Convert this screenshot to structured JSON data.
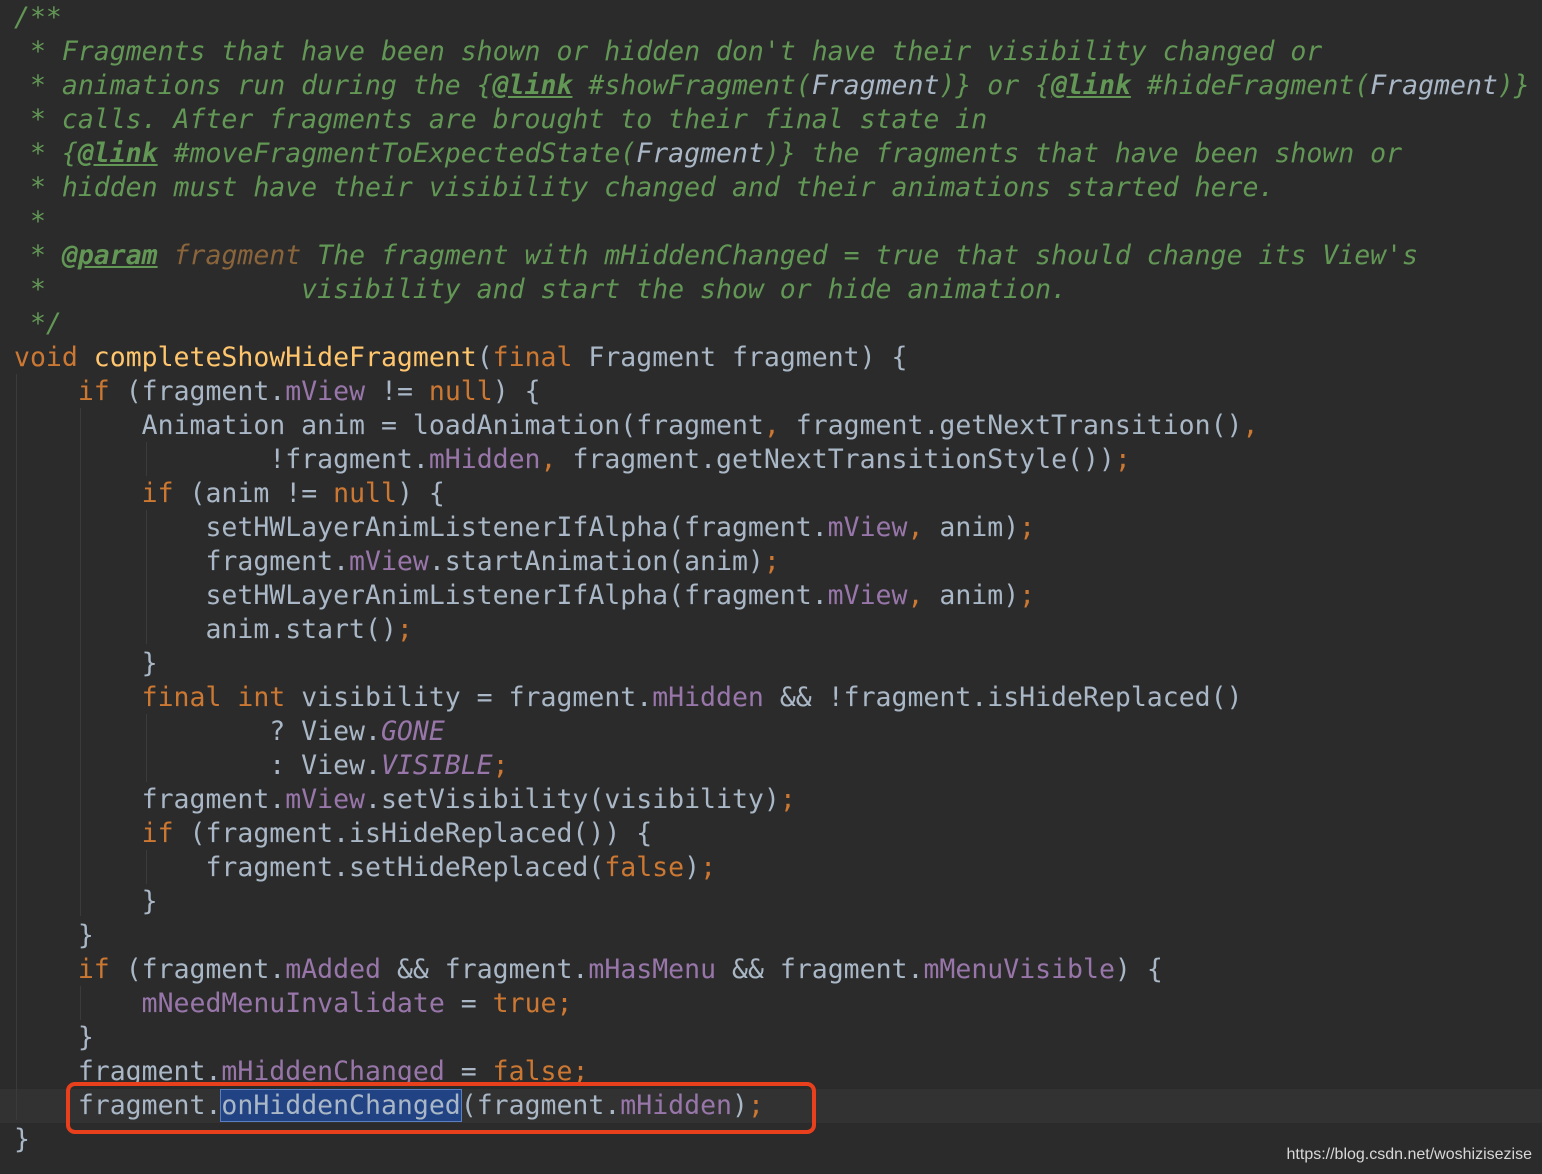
{
  "editor": {
    "theme_colors": {
      "background": "#2b2b2b",
      "plain": "#a9b7c6",
      "keyword": "#cc7832",
      "method_declaration": "#ffc66d",
      "field": "#9876aa",
      "doc_comment": "#629755",
      "highlight_box": "#e8401c",
      "selection": "#214283"
    },
    "lines": [
      {
        "tokens": [
          {
            "t": "/**",
            "c": "doc"
          }
        ]
      },
      {
        "tokens": [
          {
            "t": " * Fragments that have been shown or hidden don't have their visibility changed or",
            "c": "doc"
          }
        ]
      },
      {
        "tokens": [
          {
            "t": " * animations run during the ",
            "c": "doc"
          },
          {
            "t": "{",
            "c": "doc"
          },
          {
            "t": "@link",
            "c": "doctag"
          },
          {
            "t": " #showFragment(",
            "c": "doc"
          },
          {
            "t": "Fragment",
            "c": "docref"
          },
          {
            "t": ")} or ",
            "c": "doc"
          },
          {
            "t": "{",
            "c": "doc"
          },
          {
            "t": "@link",
            "c": "doctag"
          },
          {
            "t": " #hideFragment(",
            "c": "doc"
          },
          {
            "t": "Fragment",
            "c": "docref"
          },
          {
            "t": ")}",
            "c": "doc"
          }
        ]
      },
      {
        "tokens": [
          {
            "t": " * calls. After fragments are brought to their final state in",
            "c": "doc"
          }
        ]
      },
      {
        "tokens": [
          {
            "t": " * ",
            "c": "doc"
          },
          {
            "t": "{",
            "c": "doc"
          },
          {
            "t": "@link",
            "c": "doctag"
          },
          {
            "t": " #moveFragmentToExpectedState(",
            "c": "doc"
          },
          {
            "t": "Fragment",
            "c": "docref"
          },
          {
            "t": ")} the fragments that have been shown or",
            "c": "doc"
          }
        ]
      },
      {
        "tokens": [
          {
            "t": " * hidden must have their visibility changed and their animations started here.",
            "c": "doc"
          }
        ]
      },
      {
        "tokens": [
          {
            "t": " *",
            "c": "doc"
          }
        ]
      },
      {
        "tokens": [
          {
            "t": " * ",
            "c": "doc"
          },
          {
            "t": "@param",
            "c": "doctag"
          },
          {
            "t": " ",
            "c": "doc"
          },
          {
            "t": "fragment",
            "c": "docparam"
          },
          {
            "t": " The fragment with mHiddenChanged = true that should change its View's",
            "c": "doc"
          }
        ]
      },
      {
        "tokens": [
          {
            "t": " *                visibility and start the show or hide animation.",
            "c": "doc"
          }
        ]
      },
      {
        "tokens": [
          {
            "t": " */",
            "c": "doc"
          }
        ]
      },
      {
        "tokens": [
          {
            "t": "void ",
            "c": "kw"
          },
          {
            "t": "completeShowHideFragment",
            "c": "fn"
          },
          {
            "t": "(",
            "c": "plain"
          },
          {
            "t": "final ",
            "c": "kw"
          },
          {
            "t": "Fragment fragment) {",
            "c": "plain"
          }
        ]
      },
      {
        "tokens": [
          {
            "t": "    ",
            "c": "plain"
          },
          {
            "t": "if ",
            "c": "kw"
          },
          {
            "t": "(fragment.",
            "c": "plain"
          },
          {
            "t": "mView",
            "c": "field"
          },
          {
            "t": " != ",
            "c": "plain"
          },
          {
            "t": "null",
            "c": "kw"
          },
          {
            "t": ") {",
            "c": "plain"
          }
        ]
      },
      {
        "tokens": [
          {
            "t": "        Animation anim = loadAnimation(fragment",
            "c": "plain"
          },
          {
            "t": ", ",
            "c": "punct"
          },
          {
            "t": "fragment.getNextTransition()",
            "c": "plain"
          },
          {
            "t": ",",
            "c": "punct"
          }
        ]
      },
      {
        "tokens": [
          {
            "t": "                !fragment.",
            "c": "plain"
          },
          {
            "t": "mHidden",
            "c": "field"
          },
          {
            "t": ", ",
            "c": "punct"
          },
          {
            "t": "fragment.getNextTransitionStyle())",
            "c": "plain"
          },
          {
            "t": ";",
            "c": "punct"
          }
        ]
      },
      {
        "tokens": [
          {
            "t": "        ",
            "c": "plain"
          },
          {
            "t": "if ",
            "c": "kw"
          },
          {
            "t": "(anim != ",
            "c": "plain"
          },
          {
            "t": "null",
            "c": "kw"
          },
          {
            "t": ") {",
            "c": "plain"
          }
        ]
      },
      {
        "tokens": [
          {
            "t": "            setHWLayerAnimListenerIfAlpha(fragment.",
            "c": "plain"
          },
          {
            "t": "mView",
            "c": "field"
          },
          {
            "t": ", ",
            "c": "punct"
          },
          {
            "t": "anim)",
            "c": "plain"
          },
          {
            "t": ";",
            "c": "punct"
          }
        ]
      },
      {
        "tokens": [
          {
            "t": "            fragment.",
            "c": "plain"
          },
          {
            "t": "mView",
            "c": "field"
          },
          {
            "t": ".startAnimation(anim)",
            "c": "plain"
          },
          {
            "t": ";",
            "c": "punct"
          }
        ]
      },
      {
        "tokens": [
          {
            "t": "            setHWLayerAnimListenerIfAlpha(fragment.",
            "c": "plain"
          },
          {
            "t": "mView",
            "c": "field"
          },
          {
            "t": ", ",
            "c": "punct"
          },
          {
            "t": "anim)",
            "c": "plain"
          },
          {
            "t": ";",
            "c": "punct"
          }
        ]
      },
      {
        "tokens": [
          {
            "t": "            anim.start()",
            "c": "plain"
          },
          {
            "t": ";",
            "c": "punct"
          }
        ]
      },
      {
        "tokens": [
          {
            "t": "        }",
            "c": "plain"
          }
        ]
      },
      {
        "tokens": [
          {
            "t": "        ",
            "c": "plain"
          },
          {
            "t": "final int ",
            "c": "kw"
          },
          {
            "t": "visibility = fragment.",
            "c": "plain"
          },
          {
            "t": "mHidden",
            "c": "field"
          },
          {
            "t": " && !fragment.isHideReplaced()",
            "c": "plain"
          }
        ]
      },
      {
        "tokens": [
          {
            "t": "                ? View.",
            "c": "plain"
          },
          {
            "t": "GONE",
            "c": "const"
          }
        ]
      },
      {
        "tokens": [
          {
            "t": "                : View.",
            "c": "plain"
          },
          {
            "t": "VISIBLE",
            "c": "const"
          },
          {
            "t": ";",
            "c": "punct"
          }
        ]
      },
      {
        "tokens": [
          {
            "t": "        fragment.",
            "c": "plain"
          },
          {
            "t": "mView",
            "c": "field"
          },
          {
            "t": ".setVisibility(visibility)",
            "c": "plain"
          },
          {
            "t": ";",
            "c": "punct"
          }
        ]
      },
      {
        "tokens": [
          {
            "t": "        ",
            "c": "plain"
          },
          {
            "t": "if ",
            "c": "kw"
          },
          {
            "t": "(fragment.isHideReplaced()) {",
            "c": "plain"
          }
        ]
      },
      {
        "tokens": [
          {
            "t": "            fragment.setHideReplaced(",
            "c": "plain"
          },
          {
            "t": "false",
            "c": "kw"
          },
          {
            "t": ")",
            "c": "plain"
          },
          {
            "t": ";",
            "c": "punct"
          }
        ]
      },
      {
        "tokens": [
          {
            "t": "        }",
            "c": "plain"
          }
        ]
      },
      {
        "tokens": [
          {
            "t": "    }",
            "c": "plain"
          }
        ]
      },
      {
        "tokens": [
          {
            "t": "    ",
            "c": "plain"
          },
          {
            "t": "if ",
            "c": "kw"
          },
          {
            "t": "(fragment.",
            "c": "plain"
          },
          {
            "t": "mAdded",
            "c": "field"
          },
          {
            "t": " && fragment.",
            "c": "plain"
          },
          {
            "t": "mHasMenu",
            "c": "field"
          },
          {
            "t": " && fragment.",
            "c": "plain"
          },
          {
            "t": "mMenuVisible",
            "c": "field"
          },
          {
            "t": ") {",
            "c": "plain"
          }
        ]
      },
      {
        "tokens": [
          {
            "t": "        ",
            "c": "plain"
          },
          {
            "t": "mNeedMenuInvalidate",
            "c": "field"
          },
          {
            "t": " = ",
            "c": "plain"
          },
          {
            "t": "true",
            "c": "kw"
          },
          {
            "t": ";",
            "c": "punct"
          }
        ]
      },
      {
        "tokens": [
          {
            "t": "    }",
            "c": "plain"
          }
        ]
      },
      {
        "tokens": [
          {
            "t": "    fragment.",
            "c": "plain"
          },
          {
            "t": "mHiddenChanged",
            "c": "field"
          },
          {
            "t": " = ",
            "c": "plain"
          },
          {
            "t": "false",
            "c": "kw"
          },
          {
            "t": ";",
            "c": "punct"
          }
        ]
      },
      {
        "current": true,
        "tokens": [
          {
            "t": "    fragment.",
            "c": "plain"
          },
          {
            "t": "onHiddenChanged",
            "c": "sel"
          },
          {
            "t": "(fragment.",
            "c": "plain"
          },
          {
            "t": "mHidden",
            "c": "field"
          },
          {
            "t": ")",
            "c": "plain"
          },
          {
            "t": ";",
            "c": "punct"
          }
        ]
      },
      {
        "tokens": [
          {
            "t": "}",
            "c": "plain"
          }
        ]
      }
    ]
  },
  "watermark": {
    "text": "https://blog.csdn.net/woshizisezise"
  }
}
